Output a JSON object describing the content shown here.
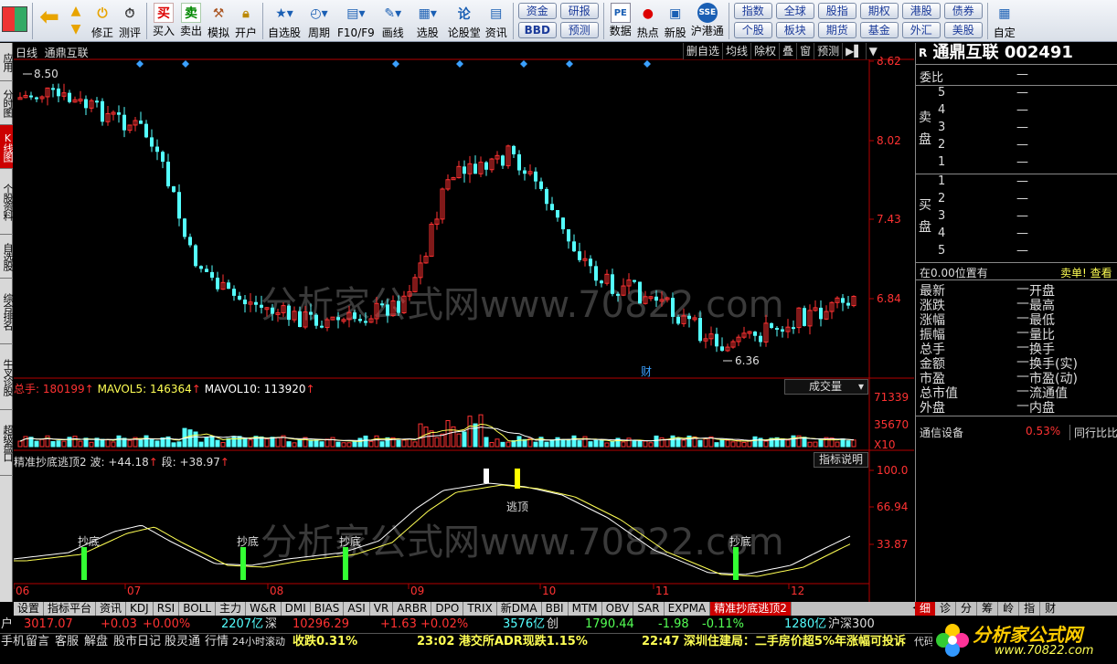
{
  "toolbar": {
    "buttons": [
      {
        "label": "修正"
      },
      {
        "label": "测评"
      },
      {
        "label": "买入"
      },
      {
        "label": "卖出"
      },
      {
        "label": "模拟"
      },
      {
        "label": "开户"
      },
      {
        "label": "自选股"
      },
      {
        "label": "周期"
      },
      {
        "label": "F10/F9"
      },
      {
        "label": "画线"
      },
      {
        "label": "选股"
      },
      {
        "label": "论股堂"
      },
      {
        "label": "资讯"
      }
    ],
    "pill_group1": [
      "资金",
      "BBD"
    ],
    "pill_group2": [
      "研报",
      "预测"
    ],
    "buttons2": [
      {
        "label": "数据"
      },
      {
        "label": "热点"
      },
      {
        "label": "新股"
      },
      {
        "label": "沪港通"
      }
    ],
    "pill_group3": [
      "指数",
      "个股"
    ],
    "pill_group4": [
      "全球",
      "板块"
    ],
    "pill_group5": [
      "股指",
      "期货"
    ],
    "pill_group6": [
      "期权",
      "基金"
    ],
    "pill_group7": [
      "港股",
      "外汇"
    ],
    "pill_group8": [
      "债券",
      "美股"
    ],
    "last_button": "自定"
  },
  "sidebar": [
    "应用",
    "分时图",
    "K线图",
    "个股资料",
    "自选股",
    "综合排名",
    "牛叉诊股",
    "超级盘口"
  ],
  "chart": {
    "period": "日线",
    "name": "通鼎互联",
    "right_buttons": [
      "删自选",
      "均线",
      "除权",
      "叠",
      "窗",
      "预测",
      "▶▌",
      "▼"
    ],
    "price_axis": [
      "8.62",
      "8.02",
      "7.43",
      "6.84"
    ],
    "high_label": "8.50",
    "low_label": "6.36",
    "cai_label": "财",
    "volume": {
      "title_label": "总手: 180199",
      "mavol5": "MAVOL5: 146364",
      "mavol10": "MAVOL10: 113920",
      "button": "成交量",
      "axis": [
        "71339",
        "35670",
        "X10"
      ]
    },
    "indicator": {
      "title": "精准抄底逃顶2",
      "wave": "波: +44.18",
      "duan": "段: +38.97",
      "button": "指标说明",
      "axis": [
        "100.0",
        "66.94",
        "33.87"
      ],
      "buy_label": "抄底",
      "sell_label": "逃顶"
    },
    "months": [
      "06",
      "07",
      "08",
      "09",
      "10",
      "11",
      "12"
    ],
    "watermark": "分析家公式网www.70822.com"
  },
  "tabs": [
    "设置",
    "指标平台",
    "资讯",
    "KDJ",
    "RSI",
    "BOLL",
    "主力",
    "W&R",
    "DMI",
    "BIAS",
    "ASI",
    "VR",
    "ARBR",
    "DPO",
    "TRIX",
    "新DMA",
    "BBI",
    "MTM",
    "OBV",
    "SAR",
    "EXPMA",
    "精准抄底逃顶2"
  ],
  "right_tabs": [
    "细",
    "诊",
    "分",
    "筹",
    "岭",
    "指",
    "财"
  ],
  "right_panel": {
    "code_prefix": "R",
    "name": "通鼎互联",
    "code": "002491",
    "weibi": "委比",
    "dash": "—",
    "sell_label": "卖盘",
    "buy_label": "买盘",
    "levels_sell": [
      "5",
      "4",
      "3",
      "2",
      "1"
    ],
    "levels_buy": [
      "1",
      "2",
      "3",
      "4",
      "5"
    ],
    "position": "在0.00位置有",
    "order": "卖单! 查看",
    "quote_left": [
      "最新",
      "涨跌",
      "涨幅",
      "振幅",
      "总手",
      "金额",
      "市盈",
      "总市值",
      "外盘"
    ],
    "quote_right": [
      "开盘",
      "最高",
      "最低",
      "量比",
      "换手",
      "换手(实)",
      "市盈(动)",
      "流通值",
      "内盘"
    ],
    "industry": "通信设备",
    "industry_pct": "0.53%",
    "compare": "同行比比"
  },
  "status1": {
    "sh_label": "户",
    "sh_val": "3017.07",
    "sh_chg": "+0.03",
    "sh_pct": "+0.00%",
    "sh_amt": "2207亿",
    "sz_label": "深",
    "sz_val": "10296.29",
    "sz_chg": "+1.63",
    "sz_pct": "+0.02%",
    "sz_amt": "3576亿",
    "cy_label": "创",
    "cy_val": "1790.44",
    "cy_chg": "-1.98",
    "cy_pct": "-0.11%",
    "hs_amt": "1280亿",
    "hs_label": "沪深300"
  },
  "status2": {
    "items": [
      "手机",
      "留言",
      "客服",
      "解盘",
      "股市日记",
      "股灵通",
      "行情",
      "24小时滚动"
    ],
    "news1": "收跌0.31%",
    "news2": "23:02 港交所ADR现跌1.15%",
    "news3": "22:47 深圳住建局：二手房价超5%年涨幅可投诉",
    "tail": "代码"
  },
  "logo": {
    "text": "分析家公式网",
    "url": "www.70822.com"
  },
  "colors": {
    "up": "#ff3232",
    "down": "#54ffff",
    "axis": "#b40000",
    "text_gray": "#c0c0c0"
  }
}
